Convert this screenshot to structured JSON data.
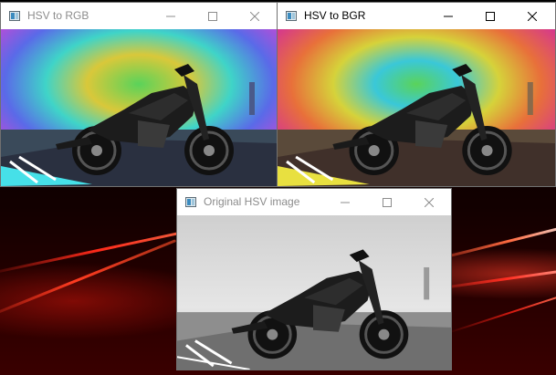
{
  "windows": {
    "rgb": {
      "title": "HSV to RGB",
      "active": false
    },
    "bgr": {
      "title": "HSV to BGR",
      "active": true
    },
    "hsv": {
      "title": "Original HSV image",
      "active": false
    }
  },
  "colors": {
    "desktop_accent": "#ff2a1a",
    "title_active": "#000000",
    "title_inactive": "#8c8c8c"
  },
  "icons": {
    "window_icon": "app-icon",
    "minimize": "minimize-icon",
    "maximize": "maximize-icon",
    "close": "close-icon"
  }
}
